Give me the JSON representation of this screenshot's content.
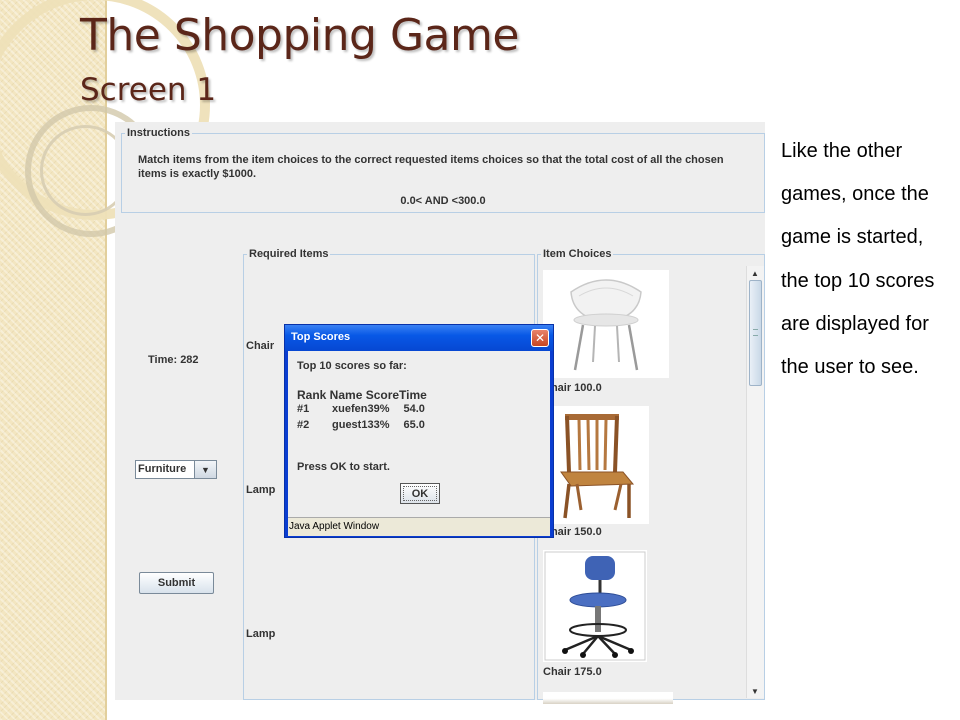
{
  "slide": {
    "title": "The Shopping Game",
    "subtitle": "Screen 1",
    "description": "Like the other games, once the game is started, the top 10 scores are displayed for the user to see."
  },
  "applet": {
    "instructions": {
      "legend": "Instructions",
      "text": "Match items from the item choices to the correct requested items choices so that the total cost of all the chosen items is exactly $1000.",
      "range": "0.0< AND <300.0"
    },
    "time_label": "Time: 282",
    "category_select": {
      "selected": "Furniture"
    },
    "submit_label": "Submit",
    "required_items": {
      "legend": "Required Items",
      "items": [
        "Chair",
        "Lamp",
        "Lamp"
      ]
    },
    "item_choices": {
      "legend": "Item Choices",
      "items": [
        {
          "label": "Chair 100.0",
          "image": "white-modern-chair"
        },
        {
          "label": "Chair 150.0",
          "image": "wooden-chair"
        },
        {
          "label": "Chair 175.0",
          "image": "blue-office-stool"
        }
      ]
    }
  },
  "dialog": {
    "title": "Top Scores",
    "intro": "Top 10 scores so far:",
    "header": "Rank Name ScoreTime",
    "rows": [
      {
        "rank": "#1",
        "name": "xuefen",
        "score": "39%",
        "time": "54.0"
      },
      {
        "rank": "#2",
        "name": "guest1",
        "score": "33%",
        "time": "65.0"
      }
    ],
    "prompt": "Press OK to start.",
    "ok_label": "OK",
    "status": "Java Applet Window"
  },
  "colors": {
    "title": "#5b2619",
    "dialog_titlebar": "#0858e6",
    "applet_bg": "#eeeeee"
  }
}
